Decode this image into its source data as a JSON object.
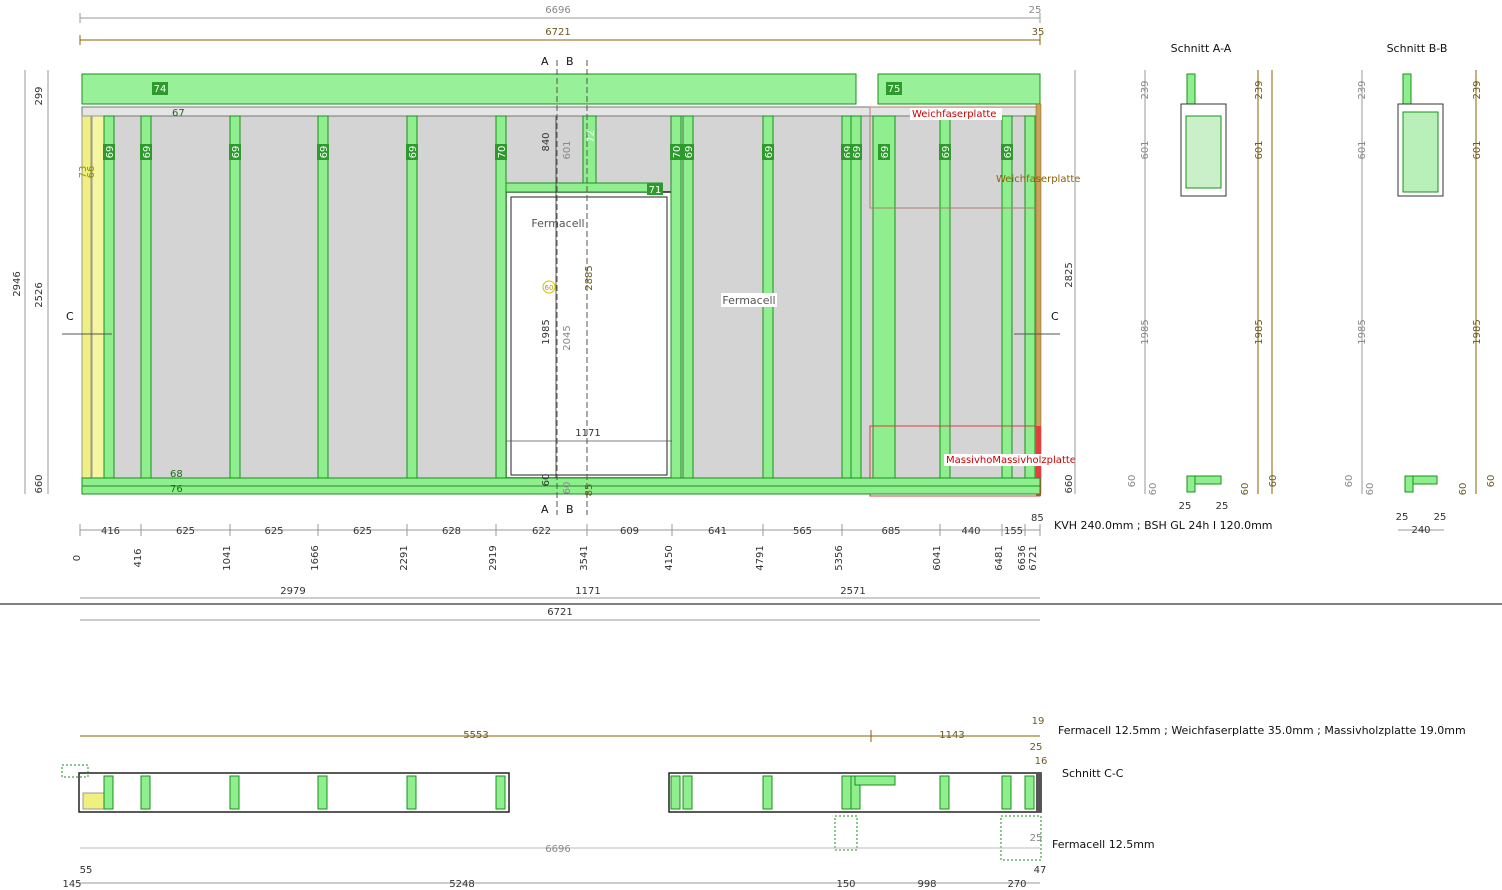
{
  "top_dims": {
    "overall_1": "6696",
    "overall_1_right": "25",
    "overall_2": "6721",
    "overall_2_right": "35"
  },
  "beams": {
    "top_left": "74",
    "top_right": "75",
    "plate": "67"
  },
  "section_marks": {
    "a": "A",
    "b": "B",
    "c": "C"
  },
  "studs": [
    {
      "n": "73",
      "color": "yellow"
    },
    {
      "n": "66",
      "color": "yellow"
    },
    {
      "n": "69"
    },
    {
      "n": "69"
    },
    {
      "n": "69"
    },
    {
      "n": "69"
    },
    {
      "n": "69"
    },
    {
      "n": "70"
    },
    {
      "n": "70"
    },
    {
      "n": "69"
    },
    {
      "n": "69"
    },
    {
      "n": "69"
    },
    {
      "n": "69"
    },
    {
      "n": "69"
    },
    {
      "n": "69"
    },
    {
      "n": "69"
    }
  ],
  "special_tags": {
    "header": "71",
    "header_post": "72",
    "bottom_1": "68",
    "bottom_2": "76",
    "window_mark": "60"
  },
  "materials": {
    "fermacell": "Fermacell",
    "weichfaser": "Weichfaserplatte",
    "weichfaser2": "Weichfaserplatte",
    "massivholz": "MassivhoMassivholzplatte"
  },
  "left_dims": {
    "h299": "299",
    "h2946": "2946",
    "h2526": "2526",
    "h660a": "660",
    "h60": "60"
  },
  "opening_dims": {
    "d840": "840",
    "d601": "601",
    "d1985": "1985",
    "d2045": "2045",
    "d2885": "2885",
    "d1171": "1171",
    "d60": "60",
    "d60b": "60",
    "d85": "85"
  },
  "right_dims": {
    "d2825": "2825",
    "d660": "660"
  },
  "bottom_segments": [
    "416",
    "625",
    "625",
    "625",
    "628",
    "622",
    "609",
    "641",
    "565",
    "685",
    "440",
    "155"
  ],
  "bottom_seg_right": "85",
  "bottom_positions": [
    "0",
    "416",
    "1041",
    "1666",
    "2291",
    "2919",
    "3541",
    "4150",
    "4791",
    "5356",
    "6041",
    "6481",
    "6636",
    "6721"
  ],
  "bottom_totals": {
    "left": "2979",
    "mid": "1171",
    "right": "2571",
    "all": "6721"
  },
  "timber_note": "KVH 240.0mm ; BSH GL 24h I 120.0mm",
  "section_a": {
    "title": "Schnitt A-A",
    "dims": [
      "239",
      "601",
      "1985",
      "60",
      "60"
    ],
    "dims_right": [
      "239",
      "601",
      "1985",
      "60",
      "60"
    ],
    "bottom": [
      "25",
      "25"
    ]
  },
  "section_b": {
    "title": "Schnitt B-B",
    "dims": [
      "239",
      "601",
      "1985",
      "60",
      "60"
    ],
    "dims_right": [
      "239",
      "601",
      "1985",
      "60",
      "60"
    ],
    "bottom": [
      "25",
      "25"
    ],
    "width": "240"
  },
  "plan": {
    "top_left": "5553",
    "top_right": "1143",
    "top_r1": "19",
    "top_r2": "25",
    "top_r3": "16",
    "note1": "Fermacell 12.5mm ; Weichfaserplatte 35.0mm ; Massivholzplatte 19.0mm",
    "title": "Schnitt C-C",
    "mid": "6696",
    "mid_right": "25",
    "note2": "Fermacell 12.5mm",
    "bottom": [
      "145",
      "55",
      "5248",
      "150",
      "998",
      "270",
      "47"
    ]
  }
}
